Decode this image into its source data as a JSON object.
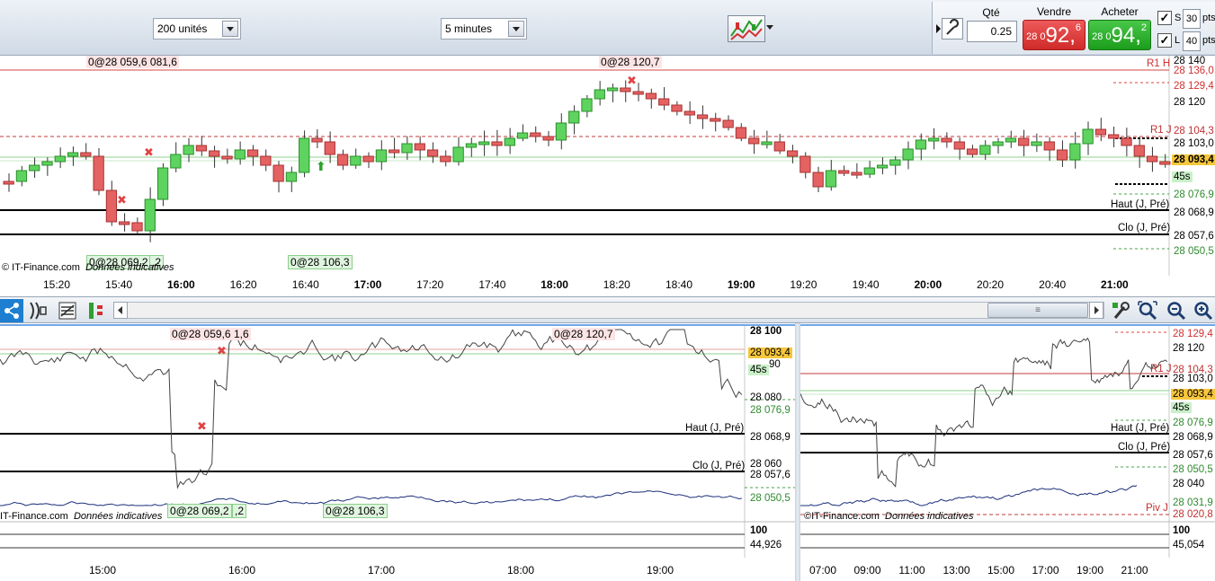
{
  "toolbar": {
    "units_select": "200 unités",
    "interval_select": "5 minutes",
    "chart_type_icon": "chart-type-icon"
  },
  "order_panel": {
    "qty_label": "Qté",
    "qty_value": "0.25",
    "sell_label": "Vendre",
    "sell_small": "28 0",
    "sell_big": "92,",
    "sell_sup": "6",
    "buy_label": "Acheter",
    "buy_small": "28 0",
    "buy_big": "94,",
    "buy_sup": "2",
    "s_label": "S",
    "l_label": "L",
    "s_pts": "30",
    "l_pts": "40",
    "pts_label": "pts",
    "colors": {
      "sell": "#d93535",
      "buy": "#27a827"
    }
  },
  "main_chart": {
    "tags": {
      "high_left": "0@28 059,6 081,6",
      "high_mid": "0@28 120,7",
      "low_left": "0@28 069,2",
      "low_left_b": ",2",
      "low_mid": "0@28 106,3"
    },
    "copyright": "© IT-Finance.com",
    "disclaimer": "Données indicatives",
    "axis_labels": [
      "28 140",
      "28 136,0",
      "28 129,4",
      "28 120",
      "28 104,3",
      "28 103,0",
      "28 093,4",
      "45s",
      "28 076,9",
      "28 068,9",
      "28 057,6",
      "28 050,5"
    ],
    "line_labels": {
      "r1h": "R1 H",
      "r1j": "R1 J",
      "haut": "Haut (J, Pré)",
      "clo": "Clo (J, Pré)"
    },
    "x_ticks": [
      "15:20",
      "15:40",
      "16:00",
      "16:20",
      "16:40",
      "17:00",
      "17:20",
      "17:40",
      "18:00",
      "18:20",
      "18:40",
      "19:00",
      "19:20",
      "19:40",
      "20:00",
      "20:20",
      "20:40",
      "21:00"
    ],
    "bold_ticks": [
      "16:00",
      "17:00",
      "18:00",
      "19:00",
      "20:00",
      "21:00"
    ]
  },
  "lower_left_chart": {
    "tags": {
      "high_left": "0@28 059,6",
      "high_left_b": "1,6",
      "high_mid": "0@28 120,7",
      "low_left": "0@28 069,2",
      "low_left_b": ",2",
      "low_mid": "0@28 106,3"
    },
    "copyright": "IT-Finance.com",
    "disclaimer": "Données indicatives",
    "axis_labels": [
      "28 100",
      "28 093,4",
      "90",
      "45s",
      "28 080",
      "28 076,9",
      "28 068,9",
      "28 060",
      "28 057,6",
      "28 050,5"
    ],
    "line_labels": {
      "haut": "Haut (J, Pré)",
      "clo": "Clo (J, Pré)"
    },
    "indicator": {
      "top": "100",
      "value": "44,926"
    },
    "x_ticks": [
      "15:00",
      "16:00",
      "17:00",
      "18:00",
      "19:00"
    ]
  },
  "lower_right_chart": {
    "copyright": "©IT-Finance.com",
    "disclaimer": "Données indicatives",
    "axis_labels": [
      "28 129,4",
      "28 120",
      "28 104,3",
      "28 103,0",
      "28 093,4",
      "45s",
      "28 076,9",
      "28 068,9",
      "28 057,6",
      "28 050,5",
      "28 040",
      "28 031,9",
      "28 020,8"
    ],
    "line_labels": {
      "r1j": "R1 J",
      "haut": "Haut (J, Pré)",
      "clo": "Clo (J, Pré)",
      "piv": "Piv J"
    },
    "indicator": {
      "top": "100",
      "value": "45,054"
    },
    "x_ticks": [
      "07:00",
      "09:00",
      "11:00",
      "13:00",
      "15:00",
      "17:00",
      "19:00",
      "21:00"
    ]
  },
  "mid_toolbar": {
    "icons": [
      "share-icon",
      "indicator-icon",
      "drawing-list-icon",
      "objects-icon",
      "scroll-left-icon",
      "scroll-right-icon",
      "tools-icon",
      "zoom-fit-icon",
      "zoom-out-icon",
      "zoom-in-icon"
    ],
    "scroll_grip": "≡"
  }
}
